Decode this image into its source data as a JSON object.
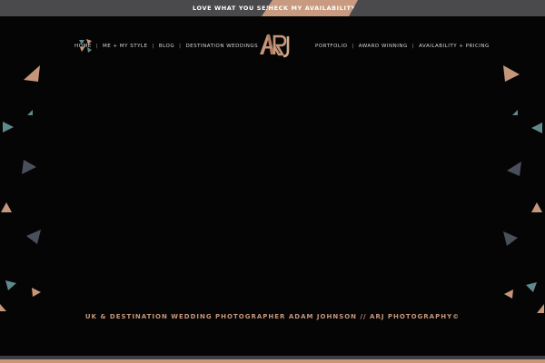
{
  "topbar": {
    "love_text": "LOVE WHAT YOU SEE?",
    "cta_label": "CHECK MY AVAILABILITY",
    "cta_color": "#c89a80"
  },
  "nav": {
    "left": [
      {
        "label": "HOME",
        "name": "nav-home"
      },
      {
        "label": "ME + MY STYLE",
        "name": "nav-me-my-style"
      },
      {
        "label": "BLOG",
        "name": "nav-blog"
      },
      {
        "label": "DESTINATION WEDDINGS",
        "name": "nav-destination-weddings"
      }
    ],
    "right": [
      {
        "label": "PORTFOLIO",
        "name": "nav-portfolio"
      },
      {
        "label": "AWARD WINNING",
        "name": "nav-award-winning"
      },
      {
        "label": "AVAILABILITY + PRICING",
        "name": "nav-availability-pricing"
      }
    ],
    "separator": "|"
  },
  "logo": {
    "text": "ARJ",
    "color": "#c6967b"
  },
  "footer": {
    "tagline": "UK & DESTINATION WEDDING PHOTOGRAPHER ADAM JOHNSON // ARJ PHOTOGRAPHY©"
  },
  "colors": {
    "background": "#050505",
    "accent": "#c6967b",
    "teal": "#5f8a8b",
    "slate": "#4a4f5c"
  },
  "icons": {
    "home": "triangle-cluster-icon",
    "decor": "triangle-icon"
  }
}
